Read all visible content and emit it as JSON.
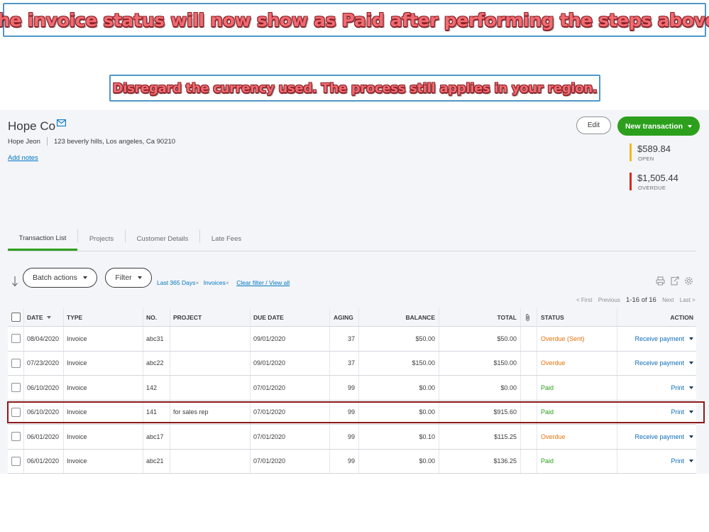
{
  "annotations": {
    "top_banner": "The invoice status will now show as Paid after performing the steps above.",
    "mid_banner": "Disregard the currency used. The process still applies in your region."
  },
  "customer": {
    "name": "Hope Co",
    "contact": "Hope Jeon",
    "address": "123 beverly hills, Los angeles, Ca 90210",
    "add_notes": "Add notes"
  },
  "header_actions": {
    "edit_label": "Edit",
    "new_transaction_label": "New transaction"
  },
  "summary": {
    "open": {
      "amount": "$589.84",
      "label": "OPEN",
      "color": "#f2b81b"
    },
    "overdue": {
      "amount": "$1,505.44",
      "label": "OVERDUE",
      "color": "#d52b1e"
    }
  },
  "tabs": [
    {
      "label": "Transaction List",
      "active": true
    },
    {
      "label": "Projects",
      "active": false
    },
    {
      "label": "Customer Details",
      "active": false
    },
    {
      "label": "Late Fees",
      "active": false
    }
  ],
  "toolbar": {
    "batch_actions": "Batch actions",
    "filter": "Filter",
    "filter_chips": [
      "Last 365 Days",
      "Invoices"
    ],
    "clear_filter": "Clear filter / View all"
  },
  "pagination": {
    "first": "< First",
    "previous": "Previous",
    "range": "1-16 of 16",
    "next": "Next",
    "last": "Last >"
  },
  "table": {
    "headers": {
      "date": "DATE",
      "type": "TYPE",
      "no": "NO.",
      "project": "PROJECT",
      "due_date": "DUE DATE",
      "aging": "AGING",
      "balance": "BALANCE",
      "total": "TOTAL",
      "status": "STATUS",
      "action": "ACTION"
    },
    "rows": [
      {
        "date": "08/04/2020",
        "type": "Invoice",
        "no": "abc31",
        "project": "",
        "due_date": "09/01/2020",
        "aging": "37",
        "balance": "$50.00",
        "total": "$50.00",
        "status": "Overdue (Sent)",
        "status_kind": "overdue",
        "action": "Receive payment"
      },
      {
        "date": "07/23/2020",
        "type": "Invoice",
        "no": "abc22",
        "project": "",
        "due_date": "09/01/2020",
        "aging": "37",
        "balance": "$150.00",
        "total": "$150.00",
        "status": "Overdue",
        "status_kind": "overdue",
        "action": "Receive payment"
      },
      {
        "date": "06/10/2020",
        "type": "Invoice",
        "no": "142",
        "project": "",
        "due_date": "07/01/2020",
        "aging": "99",
        "balance": "$0.00",
        "total": "$0.00",
        "status": "Paid",
        "status_kind": "paid",
        "action": "Print"
      },
      {
        "date": "06/10/2020",
        "type": "Invoice",
        "no": "141",
        "project": "for sales rep",
        "due_date": "07/01/2020",
        "aging": "99",
        "balance": "$0.00",
        "total": "$915.60",
        "status": "Paid",
        "status_kind": "paid",
        "action": "Print"
      },
      {
        "date": "06/01/2020",
        "type": "Invoice",
        "no": "abc17",
        "project": "",
        "due_date": "07/01/2020",
        "aging": "99",
        "balance": "$0.10",
        "total": "$115.25",
        "status": "Overdue",
        "status_kind": "overdue",
        "action": "Receive payment"
      },
      {
        "date": "06/01/2020",
        "type": "Invoice",
        "no": "abc21",
        "project": "",
        "due_date": "07/01/2020",
        "aging": "99",
        "balance": "$0.00",
        "total": "$136.25",
        "status": "Paid",
        "status_kind": "paid",
        "action": "Print"
      }
    ]
  }
}
